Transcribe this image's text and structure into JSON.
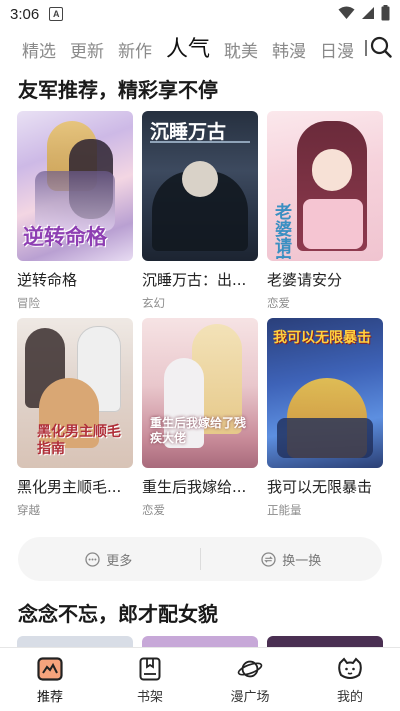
{
  "status_bar": {
    "time": "3:06",
    "notification_letter": "A"
  },
  "tabs": [
    {
      "label": "精选",
      "active": false
    },
    {
      "label": "更新",
      "active": false
    },
    {
      "label": "新作",
      "active": false
    },
    {
      "label": "人气",
      "active": true
    },
    {
      "label": "耽美",
      "active": false
    },
    {
      "label": "韩漫",
      "active": false
    },
    {
      "label": "日漫",
      "active": false
    }
  ],
  "section1": {
    "title": "友军推荐，精彩享不停",
    "comics": [
      {
        "title": "逆转命格",
        "tag": "冒险",
        "cover_text": "逆转命格"
      },
      {
        "title": "沉睡万古：出...",
        "tag": "玄幻",
        "cover_text": "沉睡万古"
      },
      {
        "title": "老婆请安分",
        "tag": "恋爱",
        "cover_text": "老婆请安分"
      },
      {
        "title": "黑化男主顺毛...",
        "tag": "穿越",
        "cover_text": "黑化男主顺毛指南"
      },
      {
        "title": "重生后我嫁给...",
        "tag": "恋爱",
        "cover_text": "重生后我嫁给了残疾大佬"
      },
      {
        "title": "我可以无限暴击",
        "tag": "正能量",
        "cover_text": "我可以无限暴击"
      }
    ]
  },
  "actions": {
    "more": "更多",
    "refresh": "换一换"
  },
  "section2": {
    "title": "念念不忘，郎才配女貌"
  },
  "bottom_nav": [
    {
      "label": "推荐",
      "icon": "recommend-icon",
      "active": true
    },
    {
      "label": "书架",
      "icon": "bookshelf-icon",
      "active": false
    },
    {
      "label": "漫广场",
      "icon": "planet-icon",
      "active": false
    },
    {
      "label": "我的",
      "icon": "profile-icon",
      "active": false
    }
  ],
  "colors": {
    "highlight": "#fbe3d4",
    "action_bg": "#f5f5f5",
    "tab_inactive": "#8a8a8a"
  }
}
